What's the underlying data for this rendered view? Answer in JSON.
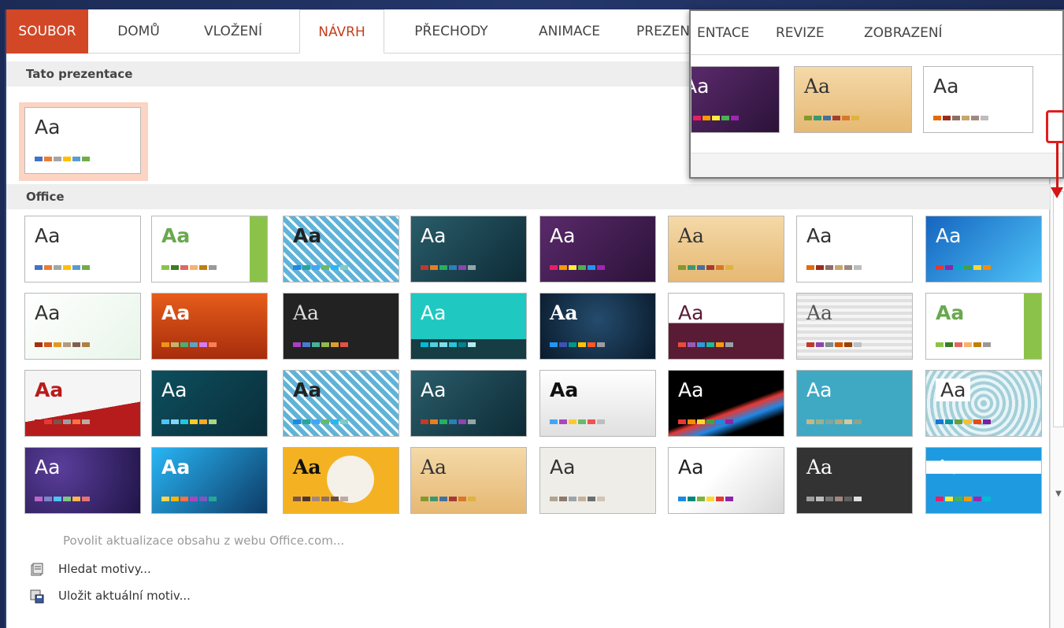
{
  "ribbon": {
    "tabs": [
      {
        "label": "SOUBOR"
      },
      {
        "label": "DOMŮ"
      },
      {
        "label": "VLOŽENÍ"
      },
      {
        "label": "NÁVRH"
      },
      {
        "label": "PŘECHODY"
      },
      {
        "label": "ANIMACE"
      },
      {
        "label": "PREZENTACE"
      },
      {
        "label": "REVIZE"
      },
      {
        "label": "ZOBRAZENÍ"
      }
    ],
    "active_tab": "NÁVRH"
  },
  "callout": {
    "tabs": [
      {
        "label": "ENTACE"
      },
      {
        "label": "REVIZE"
      },
      {
        "label": "ZOBRAZENÍ"
      }
    ]
  },
  "gallery": {
    "section_current": "Tato prezentace",
    "section_office": "Office",
    "theme_sample_text": "Aa"
  },
  "menu": {
    "enable_updates": "Povolit aktualizace obsahu z webu Office.com...",
    "browse_themes": "Hledat motivy...",
    "save_theme": "Uložit aktuální motiv..."
  },
  "colors": {
    "file_tab": "#d24726",
    "active_tab_text": "#c43e1c",
    "highlight_red": "#e21d1d",
    "frame_blue": "#24376b"
  }
}
